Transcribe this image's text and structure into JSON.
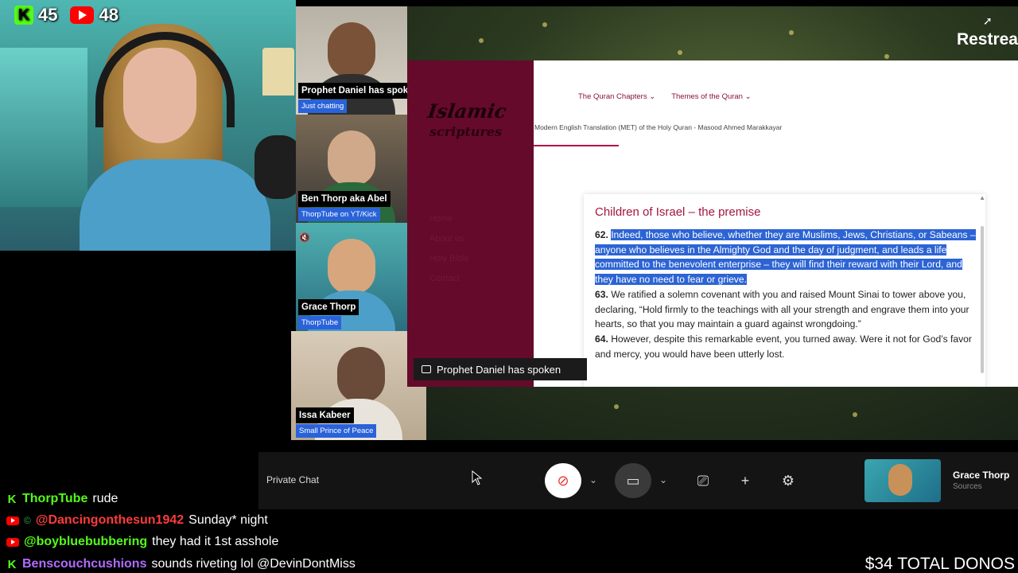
{
  "counters": {
    "kick": "45",
    "youtube": "48"
  },
  "stream": {
    "restream_label": "Restrea"
  },
  "participants": [
    {
      "name": "Prophet Daniel has spok",
      "subtitle": "Just chatting"
    },
    {
      "name": "Ben Thorp aka Abel",
      "subtitle": "ThorpTube on YT/Kick"
    },
    {
      "name": "Grace Thorp",
      "subtitle": "ThorpTube"
    },
    {
      "name": "Issa Kabeer",
      "subtitle": "Small Prince of Peace"
    }
  ],
  "site": {
    "logo_line1": "Islamic",
    "logo_line2": "scriptures",
    "nav": [
      "Home",
      "About us",
      "Holy Bible",
      "Contact"
    ],
    "menu": [
      "The Quran Chapters ⌄",
      "Themes of the Quran ⌄"
    ],
    "met_line": "Modern English Translation (MET) of the Holy Quran - Masood Ahmed Marakkayar",
    "card_title": "Children of Israel – the premise",
    "verse62_num": "62.",
    "verse62": "Indeed, those who believe, whether they are Muslims, Jews, Christians, or Sabeans – anyone who believes in the Almighty God and the day of judgment, and leads a life committed to the benevolent enterprise – they will find their reward with their Lord, and they have no need to fear or grieve.",
    "verse63_num": "63.",
    "verse63": "We ratified a solemn covenant with you and raised Mount Sinai to tower above you, declaring, “Hold firmly to the teachings with all your strength and engrave them into your hearts, so that you may maintain a guard against wrongdoing.”",
    "verse64_num": "64.",
    "verse64": "However, despite this remarkable event, you turned away. Were it not for God’s favor and mercy, you would have been utterly lost."
  },
  "spoken_banner": "Prophet Daniel has spoken",
  "controls": {
    "private_chat": "Private Chat",
    "self_name": "Grace Thorp",
    "self_sub": "Sources"
  },
  "chat": [
    {
      "platform": "kick",
      "user": "ThorpTube",
      "color": "#53fc18",
      "message": "rude"
    },
    {
      "platform": "youtube",
      "user": "@Dancingonthesun1942",
      "color": "#ff3b3b",
      "message": "Sunday* night"
    },
    {
      "platform": "youtube",
      "user": "@boybluebubbering",
      "color": "#53fc18",
      "message": "they had it 1st asshole"
    },
    {
      "platform": "kick",
      "user": "Benscouchcushions",
      "color": "#b06cff",
      "message": "sounds riveting lol @DevinDontMiss"
    }
  ],
  "donos": "$34 TOTAL DONOS"
}
